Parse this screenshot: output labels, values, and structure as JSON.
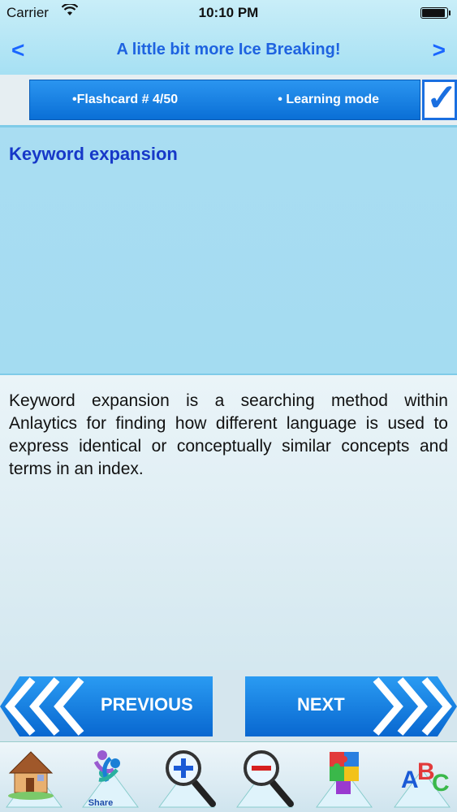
{
  "status_bar": {
    "carrier": "Carrier",
    "time": "10:10 PM",
    "wifi_icon": "wifi-icon",
    "battery_icon": "battery-icon"
  },
  "nav": {
    "back_label": "<",
    "title": "A little bit more Ice Breaking!",
    "forward_label": ">"
  },
  "info": {
    "flashcard_label": "•Flashcard #  4/50",
    "mode_label": "• Learning mode",
    "check_icon": "checkbox-checked-icon"
  },
  "card": {
    "question": "Keyword expansion",
    "answer": "Keyword expansion is a searching method within Anlaytics for finding how different language is used to express identical or conceptually similar concepts and terms in an index."
  },
  "buttons": {
    "previous_label": "PREVIOUS",
    "next_label": "NEXT"
  },
  "toolbar": {
    "items": [
      {
        "name": "home",
        "icon": "house-icon",
        "label": ""
      },
      {
        "name": "share",
        "icon": "share-icon",
        "label": "Share"
      },
      {
        "name": "zoom-in",
        "icon": "zoom-in-icon",
        "label": ""
      },
      {
        "name": "zoom-out",
        "icon": "zoom-out-icon",
        "label": ""
      },
      {
        "name": "puzzle",
        "icon": "puzzle-icon",
        "label": ""
      },
      {
        "name": "abc",
        "icon": "abc-blocks-icon",
        "label": ""
      }
    ]
  },
  "colors": {
    "accent_blue": "#1e63e0",
    "info_bar_blue": "#0a6fd6",
    "question_text": "#1638c8",
    "question_panel": "#a9ddf2"
  }
}
